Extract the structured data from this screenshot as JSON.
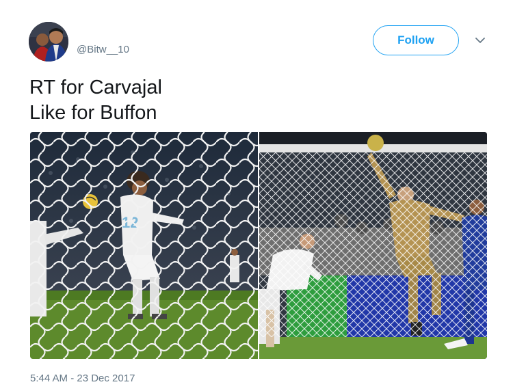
{
  "tweet": {
    "handle": "@Bitw__10",
    "follow_label": "Follow",
    "text_lines": [
      "RT for Carvajal",
      "Like for Buffon"
    ],
    "timestamp": "5:44 AM - 23 Dec 2017"
  },
  "icons": {
    "caret": "chevron-down-icon"
  },
  "colors": {
    "accent": "#1da1f2",
    "secondary_text": "#657786",
    "primary_text": "#14171a"
  }
}
